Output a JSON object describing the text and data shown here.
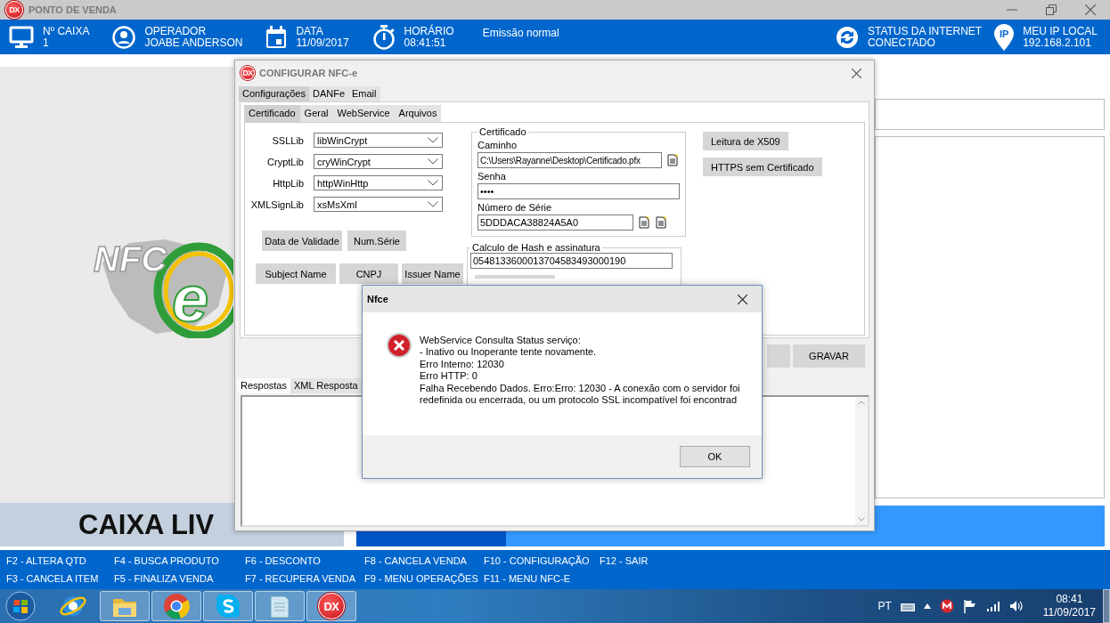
{
  "title_bar": {
    "badge": "DX",
    "title": "PONTO DE VENDA"
  },
  "header": {
    "items": [
      {
        "kind": "monitor",
        "label": "Nº CAIXA",
        "value": "1"
      },
      {
        "kind": "user",
        "label": "OPERADOR",
        "value": "JOABE ANDERSON"
      },
      {
        "kind": "calendar",
        "label": "DATA",
        "value": "11/09/2017"
      },
      {
        "kind": "timer",
        "label": "HORÁRIO",
        "value": "08:41:51"
      }
    ],
    "emission": "Emissão normal",
    "status": [
      {
        "kind": "sync",
        "label": "STATUS DA INTERNET",
        "value": "CONECTADO"
      },
      {
        "kind": "pin",
        "icon_text": "IP",
        "label": "MEU IP LOCAL",
        "value": "192.168.2.101"
      }
    ]
  },
  "logo": {
    "text": "NFC",
    "mark": "e"
  },
  "sale_status": "CAIXA LIV",
  "function_keys": [
    "F2 - ALTERA QTD",
    "F4 - BUSCA PRODUTO",
    "F6 - DESCONTO",
    "F8 - CANCELA VENDA",
    "F10 - CONFIGURAÇÃO",
    "F12 - SAIR",
    "F3 - CANCELA ITEM",
    "F5 - FINALIZA VENDA",
    "F7 - RECUPERA VENDA",
    "F9 - MENU OPERAÇÕES",
    "F11 - MENU NFC-E"
  ],
  "config_dialog": {
    "badge": "DX",
    "title": "CONFIGURAR NFC-e",
    "tabs": [
      {
        "label": "Configurações",
        "selected": true
      },
      {
        "label": "DANFe",
        "selected": false
      },
      {
        "label": "Email",
        "selected": false
      }
    ],
    "subtabs": [
      {
        "label": "Certificado",
        "selected": true
      },
      {
        "label": "Geral",
        "selected": false
      },
      {
        "label": "WebService",
        "selected": false
      },
      {
        "label": "Arquivos",
        "selected": false
      }
    ],
    "libs": [
      {
        "label": "SSLLib",
        "value": "libWinCrypt"
      },
      {
        "label": "CryptLib",
        "value": "cryWinCrypt"
      },
      {
        "label": "HttpLib",
        "value": "httpWinHttp"
      },
      {
        "label": "XMLSignLib",
        "value": "xsMsXml"
      }
    ],
    "button_rows": [
      {
        "buttons": [
          "Data de Validade",
          "Num.Série"
        ]
      },
      {
        "buttons": [
          "Subject Name",
          "CNPJ",
          "Issuer Name"
        ]
      }
    ],
    "certificate": {
      "legend": "Certificado",
      "path_label": "Caminho",
      "path": "C:\\Users\\Rayanne\\Desktop\\Certificado.pfx",
      "password_label": "Senha",
      "password": "••••",
      "serial_label": "Número de Série",
      "serial": "5DDDACA38824A5A0"
    },
    "hash": {
      "legend": "Calculo de Hash e assinatura",
      "value": "0548133600013704583493000190"
    },
    "side_buttons": [
      "Leitura de X509",
      "HTTPS sem Certificado"
    ],
    "save_button": "GRAVAR",
    "bottom_tabs": [
      {
        "label": "Respostas",
        "selected": true
      },
      {
        "label": "XML Resposta",
        "selected": false
      }
    ]
  },
  "message_box": {
    "title": "Nfce",
    "lines": [
      "WebService Consulta Status serviço:",
      "- Inativo ou Inoperante tente novamente.",
      "Erro Interno: 12030",
      "Erro HTTP: 0",
      "Falha Recebendo Dados. Erro:Erro: 12030 - A conexão com o servidor foi redefinida ou encerrada, ou um protocolo SSL incompatível foi encontrad"
    ],
    "ok": "OK"
  },
  "taskbar": {
    "apps": [
      {
        "kind": "ie",
        "running": false
      },
      {
        "kind": "folder",
        "running": true
      },
      {
        "kind": "chrome",
        "running": true
      },
      {
        "kind": "skype",
        "running": true
      },
      {
        "kind": "notepad",
        "running": true
      },
      {
        "kind": "dx",
        "running": true,
        "badge": "DX"
      }
    ],
    "language": "PT",
    "time": "08:41",
    "date": "11/09/2017"
  }
}
